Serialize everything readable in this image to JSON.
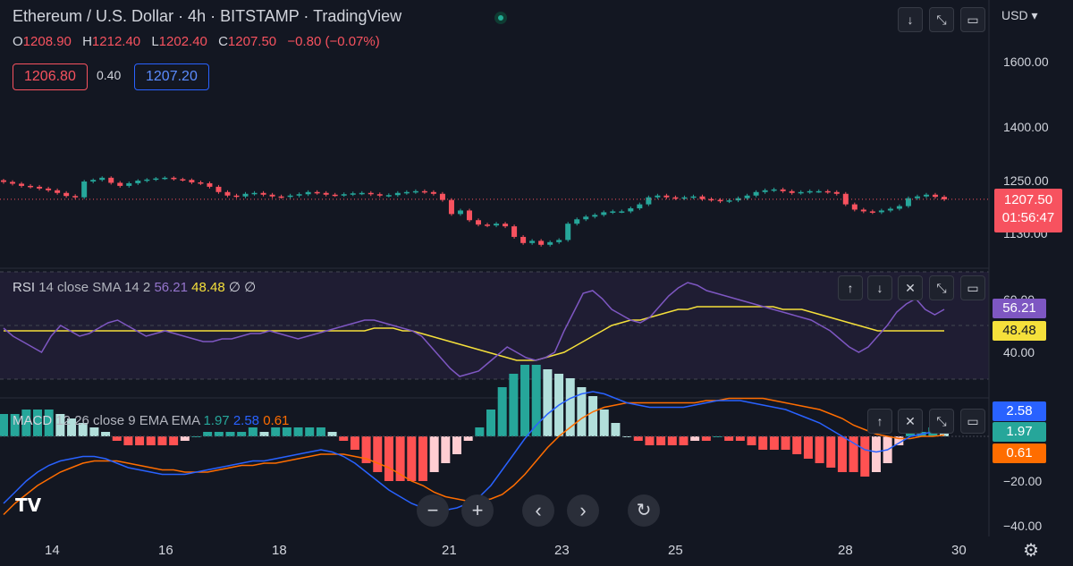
{
  "header": {
    "title": "Ethereum / U.S. Dollar · 4h · BITSTAMP · TradingView",
    "ohlc": {
      "o_key": "O",
      "o": "1208.90",
      "h_key": "H",
      "h": "1212.40",
      "l_key": "L",
      "l": "1202.40",
      "c_key": "C",
      "c": "1207.50",
      "change": "−0.80 (−0.07%)"
    },
    "bid": "1206.80",
    "spread": "0.40",
    "ask": "1207.20",
    "currency": "USD"
  },
  "price_axis": {
    "labels": [
      "1600.00",
      "1400.00",
      "1250.00",
      "1130.00"
    ],
    "current_price": "1207.50",
    "countdown": "01:56:47"
  },
  "rsi": {
    "name": "RSI",
    "params": "14 close SMA 14 2",
    "value": "56.21",
    "sma_value": "48.48",
    "extra": "∅ ∅",
    "axis_labels": [
      "60.00",
      "40.00"
    ]
  },
  "macd": {
    "name": "MACD",
    "params": "12 26 close 9 EMA EMA",
    "hist": "1.97",
    "macd": "2.58",
    "signal": "0.61",
    "axis_labels": [
      "−20.00",
      "−40.00"
    ]
  },
  "time_axis": [
    "14",
    "16",
    "18",
    "21",
    "23",
    "25",
    "28",
    "30"
  ],
  "colors": {
    "bg": "#131722",
    "up": "#26a69a",
    "down": "#f7525f",
    "rsi": "#7e57c2",
    "rsi_sma": "#f5e03b",
    "macd": "#2962ff",
    "signal": "#ff6d00"
  },
  "icons": [
    "arrow-down-icon",
    "collapse-icon",
    "restore-icon",
    "arrow-up-icon",
    "close-icon",
    "zoom-out-icon",
    "zoom-in-icon",
    "chevron-left-icon",
    "chevron-right-icon",
    "reset-icon",
    "settings-icon",
    "tradingview-logo"
  ],
  "chart_data": {
    "type": "candlestick",
    "title": "Ethereum / U.S. Dollar · 4h · BITSTAMP · TradingView",
    "ylim": [
      1080,
      1650
    ],
    "y_ticks": [
      1130,
      1250,
      1400,
      1600
    ],
    "x_ticks": [
      "14",
      "16",
      "18",
      "21",
      "23",
      "25",
      "28",
      "30"
    ],
    "close": [
      1247,
      1243,
      1238,
      1236,
      1232,
      1228,
      1222,
      1215,
      1212,
      1248,
      1252,
      1258,
      1245,
      1238,
      1244,
      1250,
      1253,
      1256,
      1258,
      1254,
      1252,
      1246,
      1244,
      1236,
      1224,
      1216,
      1214,
      1220,
      1222,
      1218,
      1214,
      1213,
      1216,
      1219,
      1224,
      1222,
      1218,
      1217,
      1219,
      1221,
      1222,
      1219,
      1216,
      1217,
      1222,
      1224,
      1226,
      1224,
      1220,
      1206,
      1174,
      1182,
      1160,
      1150,
      1148,
      1152,
      1146,
      1122,
      1108,
      1113,
      1104,
      1110,
      1115,
      1152,
      1162,
      1168,
      1172,
      1178,
      1180,
      1180,
      1187,
      1196,
      1212,
      1216,
      1212,
      1210,
      1212,
      1214,
      1208,
      1206,
      1203,
      1205,
      1210,
      1216,
      1224,
      1228,
      1230,
      1226,
      1222,
      1224,
      1226,
      1226,
      1224,
      1220,
      1196,
      1184,
      1180,
      1178,
      1182,
      1186,
      1192,
      1210,
      1214,
      1218,
      1213,
      1207.5
    ],
    "rsi": [
      49,
      46,
      44,
      42,
      40,
      46,
      50,
      48,
      46,
      47,
      49,
      51,
      52,
      50,
      48,
      46,
      47,
      48,
      47,
      46,
      45,
      44,
      44,
      45,
      45,
      46,
      47,
      47,
      48,
      47,
      46,
      45,
      46,
      47,
      48,
      49,
      50,
      51,
      52,
      52,
      51,
      50,
      49,
      48,
      46,
      42,
      38,
      34,
      31,
      32,
      33,
      36,
      39,
      42,
      40,
      38,
      37,
      38,
      40,
      48,
      55,
      62,
      63,
      60,
      56,
      54,
      52,
      51,
      53,
      57,
      61,
      64,
      66,
      65,
      63,
      62,
      61,
      60,
      59,
      58,
      57,
      56,
      55,
      54,
      53,
      52,
      50,
      48,
      45,
      42,
      40,
      42,
      46,
      50,
      55,
      58,
      60,
      56,
      54,
      56
    ],
    "rsi_sma": [
      48,
      48,
      48,
      48,
      48,
      48,
      48,
      48,
      48,
      48,
      48,
      48,
      48,
      48,
      48,
      48,
      48,
      48,
      48,
      48,
      48,
      48,
      48,
      48,
      48,
      48,
      48,
      48,
      48,
      48,
      48,
      48,
      48,
      48,
      48,
      48,
      48,
      48,
      48,
      49,
      49,
      49,
      48,
      48,
      47,
      46,
      45,
      44,
      43,
      42,
      41,
      40,
      39,
      38,
      37,
      37,
      37,
      38,
      39,
      40,
      42,
      44,
      46,
      48,
      50,
      51,
      52,
      52,
      53,
      54,
      55,
      56,
      56,
      57,
      57,
      57,
      57,
      57,
      57,
      57,
      57,
      57,
      56,
      56,
      56,
      55,
      54,
      53,
      52,
      51,
      50,
      49,
      48,
      48,
      48,
      48,
      48,
      48,
      48,
      48
    ],
    "macd": [
      -30,
      -25,
      -20,
      -16,
      -13,
      -11,
      -10,
      -9,
      -9,
      -10,
      -12,
      -14,
      -15,
      -16,
      -17,
      -17,
      -17,
      -16,
      -15,
      -14,
      -13,
      -12,
      -11,
      -11,
      -10,
      -9,
      -8,
      -7,
      -6,
      -7,
      -9,
      -12,
      -16,
      -20,
      -24,
      -27,
      -30,
      -32,
      -33,
      -33,
      -32,
      -30,
      -27,
      -22,
      -15,
      -8,
      -1,
      5,
      10,
      14,
      17,
      19,
      20,
      19,
      17,
      15,
      14,
      13,
      13,
      13,
      13,
      14,
      15,
      16,
      16,
      16,
      15,
      14,
      13,
      12,
      10,
      8,
      6,
      3,
      0,
      -3,
      -6,
      -7,
      -6,
      -3,
      0,
      1,
      2,
      2.58
    ],
    "signal": [
      -35,
      -30,
      -26,
      -22,
      -19,
      -16,
      -14,
      -12,
      -11,
      -11,
      -11,
      -12,
      -13,
      -14,
      -15,
      -15,
      -16,
      -16,
      -16,
      -15,
      -14,
      -13,
      -13,
      -12,
      -12,
      -11,
      -10,
      -9,
      -8,
      -8,
      -8,
      -9,
      -10,
      -12,
      -14,
      -17,
      -20,
      -22,
      -25,
      -27,
      -28,
      -29,
      -29,
      -28,
      -26,
      -22,
      -17,
      -11,
      -5,
      0,
      4,
      8,
      11,
      13,
      14,
      15,
      15,
      15,
      15,
      15,
      15,
      15,
      16,
      16,
      17,
      17,
      17,
      17,
      16,
      15,
      14,
      13,
      12,
      10,
      8,
      5,
      3,
      1,
      0,
      -1,
      -1,
      0,
      0,
      0.61
    ]
  }
}
